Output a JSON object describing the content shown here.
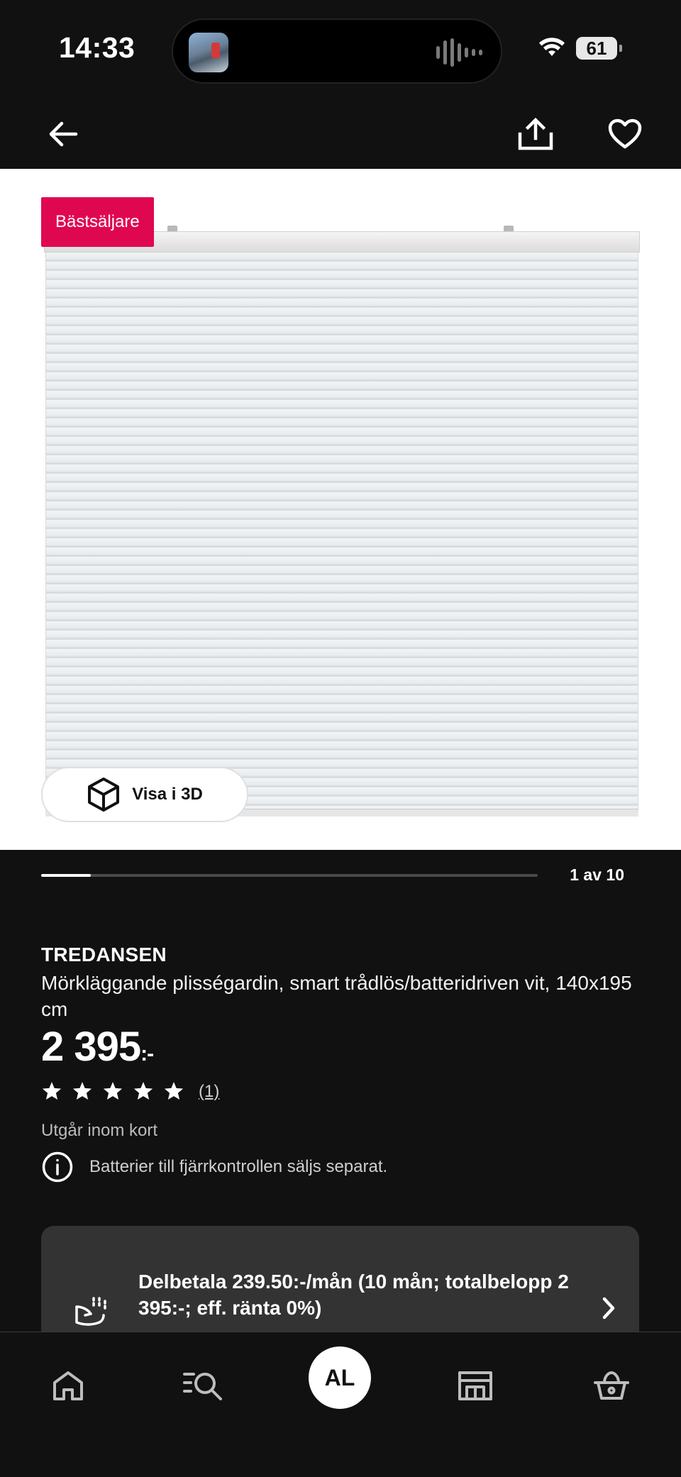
{
  "status_bar": {
    "time": "14:33",
    "battery": "61",
    "icons": [
      "now-playing-thumbnail",
      "audio-waveform-icon",
      "wifi-icon",
      "battery-icon"
    ]
  },
  "top_nav": {
    "icons": [
      "back-arrow-icon",
      "share-icon",
      "heart-icon"
    ]
  },
  "product_image": {
    "badge": "Bästsäljare",
    "badge_color": "#e00751",
    "view_3d_label": "Visa i 3D"
  },
  "carousel": {
    "counter": "1 av 10",
    "current": 1,
    "total": 10
  },
  "product": {
    "name": "TREDANSEN",
    "description": "Mörkläggande plisségardin, smart trådlös/batteridriven vit, 140x195 cm",
    "price": "2 395",
    "price_suffix": ":-",
    "rating_stars": 5,
    "rating_count": "(1)",
    "availability": "Utgår inom kort",
    "notice": "Batterier till fjärrkontrollen säljs separat."
  },
  "payment": {
    "text": "Delbetala 239.50:-/mån (10 mån; totalbelopp 2 395:-; eff. ränta 0%)"
  },
  "tab_bar": {
    "avatar_initials": "AL",
    "icons": [
      "home-icon",
      "search-list-icon",
      "store-icon",
      "basket-icon"
    ]
  }
}
